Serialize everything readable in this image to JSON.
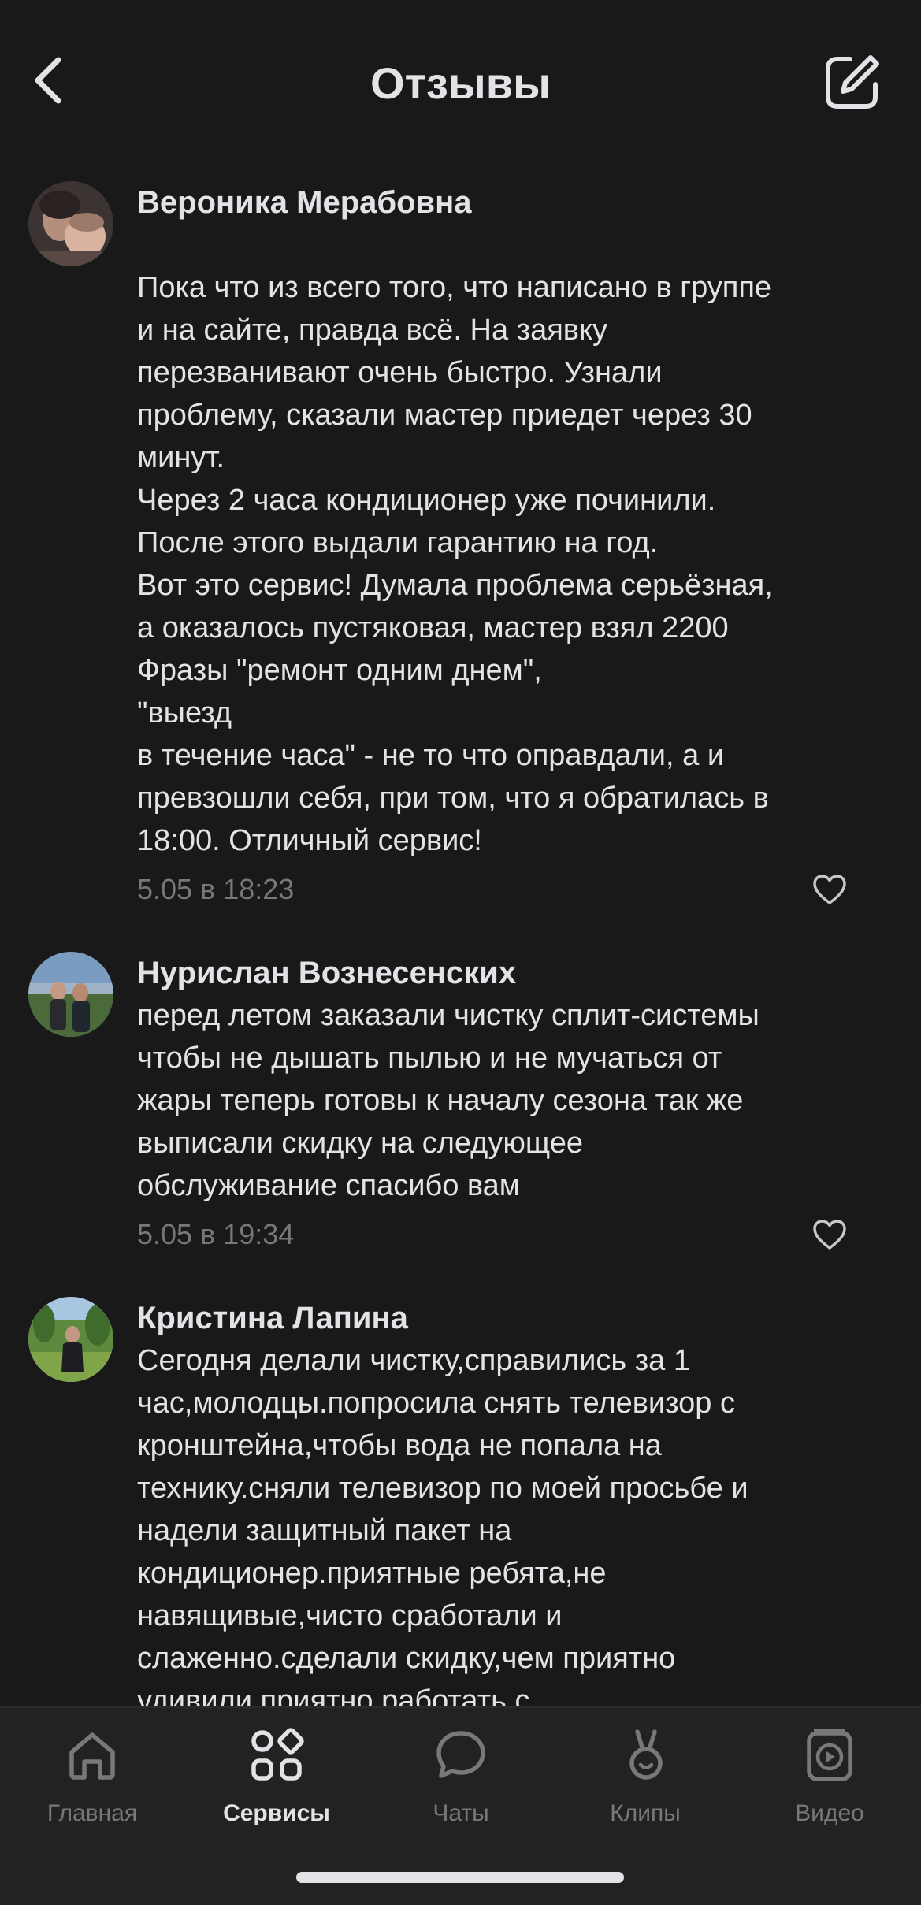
{
  "header": {
    "title": "Отзывы",
    "back_icon": "chevron-left-icon",
    "compose_icon": "compose-icon"
  },
  "reviews": [
    {
      "author": "Вероника Мерабовна",
      "text": "\nПока что из всего того, что написано в группе\nи на сайте, правда всё. На заявку\nперезванивают очень быстро. Узнали\nпроблему, сказали мастер приедет через 30\nминут.\nЧерез 2 часа кондиционер уже починили.\nПосле этого выдали гарантию на год.\nВот это сервис! Думала проблема серьёзная,\nа оказалось пустяковая, мастер взял 2200\nФразы \"ремонт одним днем\",\n\"выезд\nв течение часа\" - не то что оправдали, а и\nпревзошли себя, при том, что я обратилась в\n18:00. Отличный сервис!",
      "date": "5.05 в 18:23"
    },
    {
      "author": "Нурислан Вознесенских",
      "text": "перед летом заказали чистку сплит-системы\nчтобы не дышать пылью и не мучаться от\nжары теперь готовы к началу сезона так же\nвыписали скидку на следующее\nобслуживание спасибо вам",
      "date": "5.05 в 19:34"
    },
    {
      "author": "Кристина Лапина",
      "text": "Сегодня делали чистку,справились за 1\nчас,молодцы.попросила снять телевизор с\nкронштейна,чтобы вода не попала на\nтехнику.сняли телевизор по моей просьбе и\nнадели защитный пакет на\nкондиционер.приятные ребята,не\nнавящивые,чисто сработали и\nслаженно.сделали скидку,чем приятно\nудивили.приятно работать с",
      "date": ""
    }
  ],
  "tabbar": {
    "tabs": [
      {
        "label": "Главная",
        "icon": "home-icon"
      },
      {
        "label": "Сервисы",
        "icon": "services-icon"
      },
      {
        "label": "Чаты",
        "icon": "chat-icon"
      },
      {
        "label": "Клипы",
        "icon": "clips-icon"
      },
      {
        "label": "Видео",
        "icon": "video-icon"
      }
    ],
    "active": "Сервисы"
  },
  "colors": {
    "background": "#191919",
    "text": "#e1e3e6",
    "secondary": "#76787a",
    "tabbar": "#222222"
  }
}
